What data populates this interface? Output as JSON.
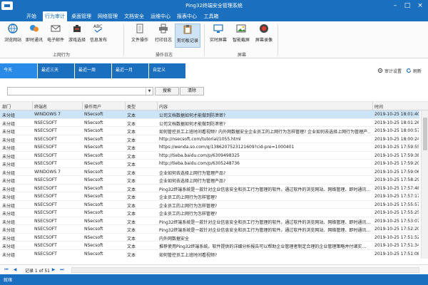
{
  "window": {
    "title": "Ping32终端安全管理系统"
  },
  "menu": [
    {
      "label": "开始",
      "active": false
    },
    {
      "label": "行为审计",
      "active": true
    },
    {
      "label": "桌面管理",
      "active": false
    },
    {
      "label": "网络管理",
      "active": false
    },
    {
      "label": "文档安全",
      "active": false
    },
    {
      "label": "运维中心",
      "active": false
    },
    {
      "label": "报表中心",
      "active": false
    },
    {
      "label": "工具箱",
      "active": false
    }
  ],
  "ribbon": {
    "groups": [
      {
        "label": "上网行为",
        "buttons": [
          {
            "label": "浏览网站",
            "icon": "browser-icon"
          },
          {
            "label": "即时通讯",
            "icon": "chat-icon"
          },
          {
            "label": "电子邮件",
            "icon": "email-icon"
          },
          {
            "label": "游戏选择",
            "icon": "game-icon"
          },
          {
            "label": "信息发布",
            "icon": "abc-icon"
          }
        ]
      },
      {
        "label": "操作日志",
        "buttons": [
          {
            "label": "文件操作",
            "icon": "file-icon"
          },
          {
            "label": "打印日志",
            "icon": "printer-icon"
          },
          {
            "label": "剪切板记录",
            "icon": "clipboard-icon"
          }
        ]
      },
      {
        "label": "屏幕",
        "buttons": [
          {
            "label": "实时屏幕",
            "icon": "monitor-icon"
          },
          {
            "label": "智能截屏",
            "icon": "screenshot-icon"
          },
          {
            "label": "屏幕录像",
            "icon": "record-icon"
          }
        ]
      }
    ]
  },
  "tabs": [
    {
      "label": "今天"
    },
    {
      "label": "最近三天"
    },
    {
      "label": "最近一周"
    },
    {
      "label": "最近一月"
    },
    {
      "label": "自定义"
    }
  ],
  "toolbar_links": {
    "audit_settings": "审计设置",
    "refresh": "刷新"
  },
  "filter": {
    "search_value": "",
    "search_button": "搜索",
    "clear_button": "清除"
  },
  "table": {
    "columns": [
      "部门",
      "终端名",
      "操作用户",
      "类型",
      "内容",
      "时间"
    ],
    "rows": [
      [
        "未分组",
        "WINDOWS 7",
        "NSecsoft",
        "文本",
        "公司文档数据如何才能做到防泄密?",
        "2019-10-25 18:01:40"
      ],
      [
        "未分组",
        "NSECSOFT",
        "NSecsoft",
        "文本",
        "公司文档数据如何才能做到防泄密?",
        "2019-10-25 18:01:26"
      ],
      [
        "未分组",
        "NSECSOFT",
        "NSecsoft",
        "文本",
        "如何管控员工上班时间看视频? 内外网数据安全企业员工的上网行为怎样管理? 企业如何去选择上网行为管理产…",
        "2019-10-25 18:00:57"
      ],
      [
        "未分组",
        "NSECSOFT",
        "NSecsoft",
        "文本",
        "http://nsecsoft.com/tutorial/1055.html",
        "2019-10-25 18:00:24"
      ],
      [
        "未分组",
        "NSECSOFT",
        "NSecsoft",
        "文本",
        "https://wenda.so.com/q/1386207523121609?cid-pre=1000401",
        "2019-10-25 17:59:55"
      ],
      [
        "未分组",
        "NSECSOFT",
        "NSecsoft",
        "文本",
        "http://tieba.baidu.com/p/6309498325",
        "2019-10-25 17:59:38"
      ],
      [
        "未分组",
        "NSECSOFT",
        "NSecsoft",
        "文本",
        "http://tieba.baidu.com/p/6305248736",
        "2019-10-25 17:59:20"
      ],
      [
        "未分组",
        "WINDOWS 7",
        "NSecsoft",
        "文本",
        "企业如何去选择上网行为管理产品?",
        "2019-10-25 17:59:06"
      ],
      [
        "未分组",
        "NSECSOFT",
        "NSecsoft",
        "文本",
        "企业如何去选择上网行为管理产品?",
        "2019-10-25 17:58:29"
      ],
      [
        "未分组",
        "NSECSOFT",
        "NSecsoft",
        "文本",
        "Ping32终端系统是一款针对企业信息安全和员工行为管理的软件。通过软件的浏览网站、网络管理、即时通讯…",
        "2019-10-25 17:57:48"
      ],
      [
        "未分组",
        "NSECSOFT",
        "NSecsoft",
        "文本",
        "企业员工的上网行为怎样管理?",
        "2019-10-25 17:57:17"
      ],
      [
        "未分组",
        "NSECSOFT",
        "NSecsoft",
        "文本",
        "企业员工的上网行为怎样管理?",
        "2019-10-25 17:55:57"
      ],
      [
        "未分组",
        "NSECSOFT",
        "NSecsoft",
        "文本",
        "企业员工的上网行为怎样管理?",
        "2019-10-25 17:55:25"
      ],
      [
        "未分组",
        "NSECSOFT",
        "NSecsoft",
        "文本",
        "Ping32终端系统是一款针对企业信息安全和员工行为管理的软件。通过软件的浏览网站、网络管理、即时通讯…",
        "2019-10-25 17:53:07"
      ],
      [
        "未分组",
        "NSECSOFT",
        "NSecsoft",
        "文本",
        "Ping32终端系统是一款针对企业信息安全和员工行为管理的软件。通过软件的浏览网站、网络管理、即时通讯…",
        "2019-10-25 17:52:20"
      ],
      [
        "未分组",
        "NSECSOFT",
        "NSecsoft",
        "文本",
        "内外网数据安全",
        "2019-10-25 17:51:52"
      ],
      [
        "未分组",
        "NSECSOFT",
        "NSecsoft",
        "文本",
        "推荐使用Ping32终端系统。软件提供的详细分析报告可以帮助企业管理者制定合理的企业管理策略并付诸实…",
        "2019-10-25 17:51:34"
      ],
      [
        "未分组",
        "NSECSOFT",
        "NSecsoft",
        "文本",
        "如何管控员工上班时间看视频?",
        "2019-10-25 17:51:08"
      ]
    ]
  },
  "pager": {
    "text": "记录 1 of 51"
  },
  "status": {
    "text": "就绪"
  }
}
